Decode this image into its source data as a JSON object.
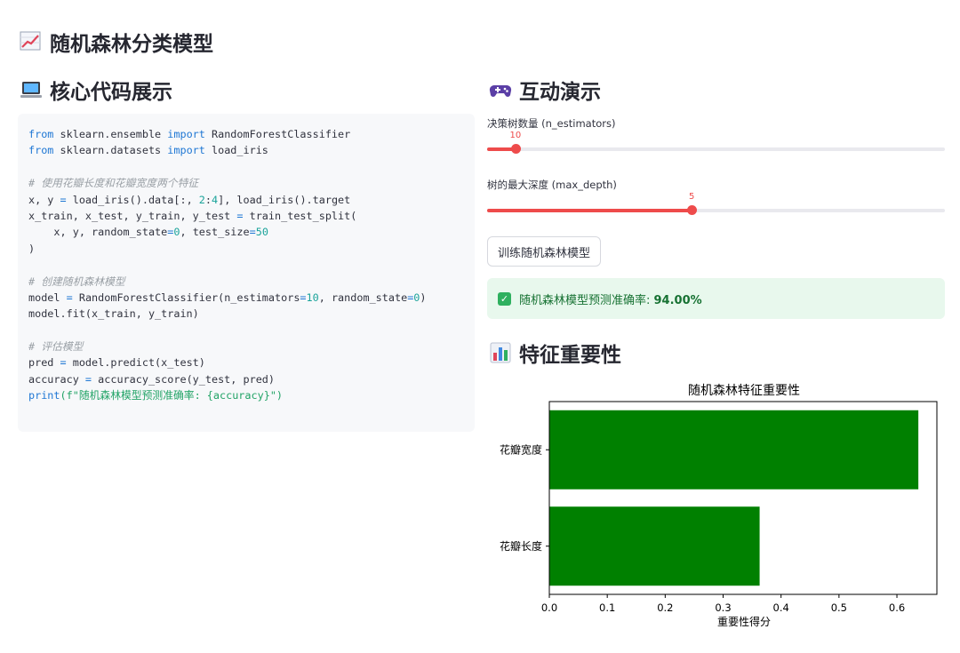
{
  "app": {
    "title": "随机森林分类模型",
    "title_icon": "chart-increasing-icon"
  },
  "code_section": {
    "heading": "核心代码展示",
    "icon": "laptop-icon",
    "lines": [
      [
        {
          "t": "from",
          "c": "kw"
        },
        {
          "t": " sklearn.ensemble "
        },
        {
          "t": "import",
          "c": "kw"
        },
        {
          "t": " RandomForestClassifier"
        }
      ],
      [
        {
          "t": "from",
          "c": "kw"
        },
        {
          "t": " sklearn.datasets "
        },
        {
          "t": "import",
          "c": "kw"
        },
        {
          "t": " load_iris"
        }
      ],
      [],
      [
        {
          "t": "# 使用花瓣长度和花瓣宽度两个特征",
          "c": "cm"
        }
      ],
      [
        {
          "t": "x, y "
        },
        {
          "t": "=",
          "c": "kw"
        },
        {
          "t": " load_iris().data[:, "
        },
        {
          "t": "2",
          "c": "num"
        },
        {
          "t": ":"
        },
        {
          "t": "4",
          "c": "num"
        },
        {
          "t": "], load_iris().target"
        }
      ],
      [
        {
          "t": "x_train, x_test, y_train, y_test "
        },
        {
          "t": "=",
          "c": "kw"
        },
        {
          "t": " train_test_split("
        }
      ],
      [
        {
          "t": "    x, y, random_state"
        },
        {
          "t": "=",
          "c": "kw"
        },
        {
          "t": "0",
          "c": "num"
        },
        {
          "t": ", test_size"
        },
        {
          "t": "=",
          "c": "kw"
        },
        {
          "t": "50",
          "c": "num"
        }
      ],
      [
        {
          "t": ")"
        }
      ],
      [],
      [
        {
          "t": "# 创建随机森林模型",
          "c": "cm"
        }
      ],
      [
        {
          "t": "model "
        },
        {
          "t": "=",
          "c": "kw"
        },
        {
          "t": " RandomForestClassifier(n_estimators"
        },
        {
          "t": "=",
          "c": "kw"
        },
        {
          "t": "10",
          "c": "num"
        },
        {
          "t": ", random_state"
        },
        {
          "t": "=",
          "c": "kw"
        },
        {
          "t": "0",
          "c": "num"
        },
        {
          "t": ")"
        }
      ],
      [
        {
          "t": "model.fit(x_train, y_train)"
        }
      ],
      [],
      [
        {
          "t": "# 评估模型",
          "c": "cm"
        }
      ],
      [
        {
          "t": "pred "
        },
        {
          "t": "=",
          "c": "kw"
        },
        {
          "t": " model.predict(x_test)"
        }
      ],
      [
        {
          "t": "accuracy "
        },
        {
          "t": "=",
          "c": "kw"
        },
        {
          "t": " accuracy_score(y_test, pred)"
        }
      ],
      [
        {
          "t": "print",
          "c": "fn"
        },
        {
          "t": "(f\"随机森林模型预测准确率: {accuracy}\")",
          "c": "str"
        }
      ]
    ]
  },
  "demo": {
    "heading": "互动演示",
    "icon": "game-controller-icon",
    "slider1": {
      "label": "决策树数量 (n_estimators)",
      "value": "10",
      "fraction": 0.062
    },
    "slider2": {
      "label": "树的最大深度 (max_depth)",
      "value": "5",
      "fraction": 0.447
    },
    "train_button": "训练随机森林模型",
    "success_prefix": "随机森林模型预测准确率: ",
    "success_value": "94.00%"
  },
  "importance": {
    "heading": "特征重要性",
    "icon": "bar-chart-icon"
  },
  "chart_data": {
    "type": "bar",
    "orientation": "horizontal",
    "title": "随机森林特征重要性",
    "xlabel": "重要性得分",
    "ylabel": "",
    "categories": [
      "花瓣宽度",
      "花瓣长度"
    ],
    "values": [
      0.637,
      0.363
    ],
    "xlim": [
      0,
      0.669
    ],
    "xticks": [
      0.0,
      0.1,
      0.2,
      0.3,
      0.4,
      0.5,
      0.6
    ],
    "xtick_labels": [
      "0.0",
      "0.1",
      "0.2",
      "0.3",
      "0.4",
      "0.5",
      "0.6"
    ],
    "bar_color": "#008000",
    "grid": false
  },
  "colors": {
    "accent": "#ee4b4b",
    "success_bg": "#e8f8ed",
    "success_text": "#177233"
  }
}
